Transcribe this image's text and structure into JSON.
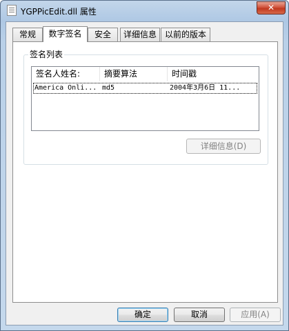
{
  "window": {
    "title": "YGPPicEdit.dll 属性",
    "close_glyph": "✕"
  },
  "tabs": [
    {
      "label": "常规",
      "active": false
    },
    {
      "label": "数字签名",
      "active": true
    },
    {
      "label": "安全",
      "active": false
    },
    {
      "label": "详细信息",
      "active": false
    },
    {
      "label": "以前的版本",
      "active": false
    }
  ],
  "signature_group": {
    "title": "签名列表",
    "columns": [
      "签名人姓名:",
      "摘要算法",
      "时间戳"
    ],
    "rows": [
      {
        "signer": "America Onli...",
        "digest": "md5",
        "timestamp": "2004年3月6日 11..."
      }
    ],
    "details_button": "详细信息(D)"
  },
  "buttons": {
    "ok": "确定",
    "cancel": "取消",
    "apply": "应用(A)"
  },
  "colors": {
    "titlebar": "#b9d0e8",
    "close_button": "#c7432b",
    "default_button_border": "#3c7fb1"
  }
}
